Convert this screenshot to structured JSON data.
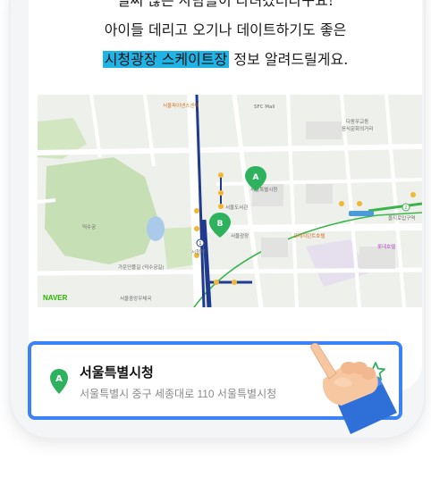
{
  "headline": {
    "line1": "벌써 많은 사람들이 다녀갔더라구요!",
    "line2": "아이들 데리고 오기나 데이트하기도 좋은",
    "line3_highlight": "시청광장 스케이트장",
    "line3_rest": " 정보 알려드릴게요."
  },
  "map": {
    "brand": "NAVER",
    "labels": {
      "sfc_mall": "SFC Mall",
      "dadong": "다동우교동",
      "eumsik": "음식문화의거리",
      "deoksugung": "덕수궁",
      "city_hall": "서울특별시청",
      "city_hall_station": "시청역",
      "plaza": "서울광장",
      "deoksugung_gate": "가운단플길\n(덕수궁길)",
      "plaza_hotel": "프레지던트호텔",
      "euljiro_station": "을지로입구역",
      "city_library": "서울도서관",
      "lotte_hotel": "롯데호텔",
      "gwanghwamun_post": "서울중앙우체국",
      "seoul_finance": "서울파이낸스센터",
      "pin_a": "A",
      "pin_b": "B",
      "line_1": "1",
      "line_2": "2"
    },
    "colors": {
      "line1": "#1f3b8f",
      "line2": "#3ab54a",
      "park": "#c7dfb4",
      "road": "#ffffff",
      "water": "#a9cbe9",
      "pin": "#2fb25e"
    }
  },
  "place": {
    "pin_letter": "A",
    "name": "서울특별시청",
    "address": "서울특별시 중구 세종대로 110 서울특별시청",
    "accent": "#3b82f6"
  }
}
